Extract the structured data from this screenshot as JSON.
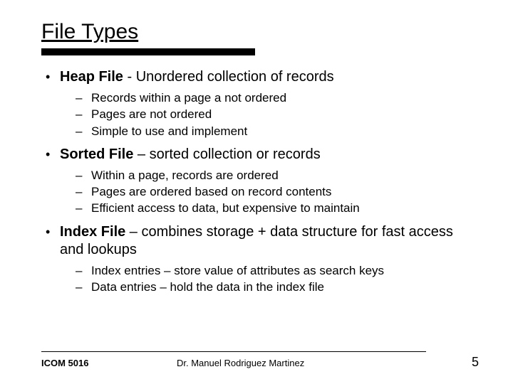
{
  "title": "File Types",
  "items": [
    {
      "strong": "Heap File",
      "rest": " - Unordered collection of records",
      "sub": [
        "Records within a page a not ordered",
        "Pages are not ordered",
        "Simple to use and implement"
      ]
    },
    {
      "strong": "Sorted File",
      "rest": " – sorted collection or records",
      "sub": [
        "Within a page, records are ordered",
        "Pages are ordered based on record contents",
        "Efficient access to data, but expensive to maintain"
      ]
    },
    {
      "strong": "Index File",
      "rest": " – combines storage + data structure for fast access and lookups",
      "sub": [
        "Index entries – store value of attributes as search keys",
        "Data entries – hold the data in the index file"
      ]
    }
  ],
  "footer": {
    "left": "ICOM 5016",
    "center": "Dr. Manuel Rodriguez Martinez",
    "right": "5"
  },
  "chart_data": {
    "type": "table",
    "title": "File Types",
    "series": [
      {
        "name": "Heap File - Unordered collection of records",
        "values": [
          "Records within a page a not ordered",
          "Pages are not ordered",
          "Simple to use and implement"
        ]
      },
      {
        "name": "Sorted File – sorted collection or records",
        "values": [
          "Within a page, records are ordered",
          "Pages are ordered based on record contents",
          "Efficient access to data, but expensive to maintain"
        ]
      },
      {
        "name": "Index File – combines storage + data structure for fast access and lookups",
        "values": [
          "Index entries – store value of attributes as search keys",
          "Data entries – hold the data in the index file"
        ]
      }
    ]
  }
}
